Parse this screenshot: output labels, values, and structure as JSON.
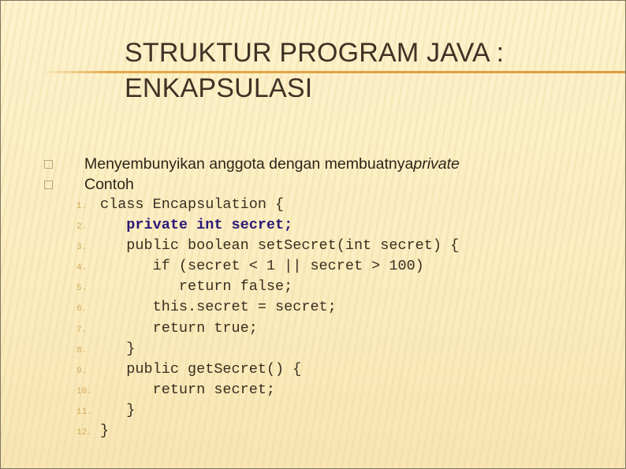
{
  "slide": {
    "title": "STRUKTUR PROGRAM JAVA :\nENKAPSULASI",
    "bullets": [
      {
        "text": "Menyembunyikan anggota dengan membuatnya ",
        "emphasis": "private"
      },
      {
        "text": "Contoh",
        "emphasis": ""
      }
    ],
    "bullet_icon": "square-bullet-icon",
    "code": [
      {
        "num": "1.",
        "text": "class Encapsulation {"
      },
      {
        "num": "2.",
        "text": "   private int secret;"
      },
      {
        "num": "3.",
        "text": "   public boolean setSecret(int secret) {"
      },
      {
        "num": "4.",
        "text": "      if (secret < 1 || secret > 100)"
      },
      {
        "num": "5.",
        "text": "         return false;"
      },
      {
        "num": "6.",
        "text": "      this.secret = secret;"
      },
      {
        "num": "7.",
        "text": "      return true;"
      },
      {
        "num": "8.",
        "text": "   }"
      },
      {
        "num": "9.",
        "text": "   public getSecret() {"
      },
      {
        "num": "10.",
        "text": "      return secret;"
      },
      {
        "num": "11.",
        "text": "   }"
      },
      {
        "num": "12.",
        "text": "}"
      }
    ],
    "colors": {
      "background": "#fdf1c8",
      "title_text": "#3f3225",
      "accent_line": "#dc9c3e",
      "keyword_highlight": "#2a1778",
      "line_number": "#d3a95c"
    }
  }
}
